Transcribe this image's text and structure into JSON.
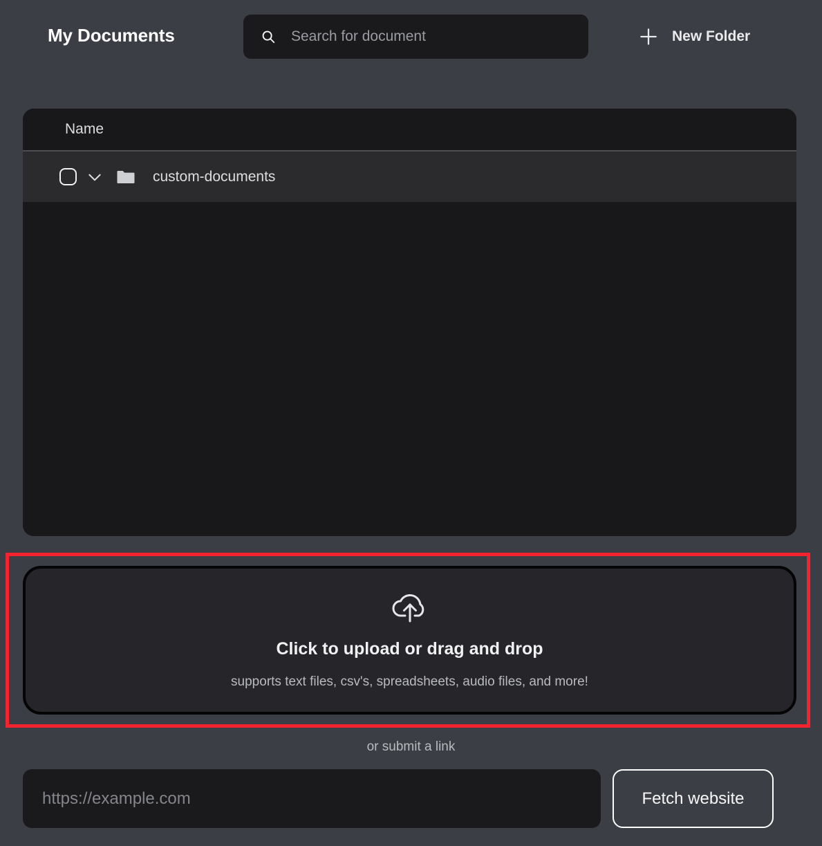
{
  "header": {
    "title": "My Documents",
    "search": {
      "placeholder": "Search for document",
      "value": "",
      "icon": "search-icon"
    },
    "new_folder": {
      "label": "New Folder",
      "icon": "plus-icon"
    }
  },
  "file_table": {
    "columns": [
      "Name"
    ],
    "rows": [
      {
        "name": "custom-documents",
        "type": "folder",
        "checked": false,
        "expanded": false,
        "checkbox_icon": "checkbox-unchecked-icon",
        "chevron_icon": "chevron-down-icon",
        "type_icon": "folder-icon"
      }
    ]
  },
  "dropzone": {
    "icon": "cloud-upload-icon",
    "title": "Click to upload or drag and drop",
    "subtitle": "supports text files, csv's, spreadsheets, audio files, and more!",
    "highlighted": true,
    "highlight_color": "#f42330"
  },
  "submit_link": {
    "label": "or submit a link",
    "url_input": {
      "placeholder": "https://example.com",
      "value": ""
    },
    "fetch_button_label": "Fetch website"
  },
  "colors": {
    "page_background": "#3b3e44",
    "panel_background": "#18181a",
    "row_background": "#2b2b2d",
    "input_background": "#1a1a1d",
    "dropzone_background": "#26262a",
    "accent_highlight": "#f42330",
    "text_primary": "#ffffff",
    "text_secondary": "#b9bbbf"
  }
}
